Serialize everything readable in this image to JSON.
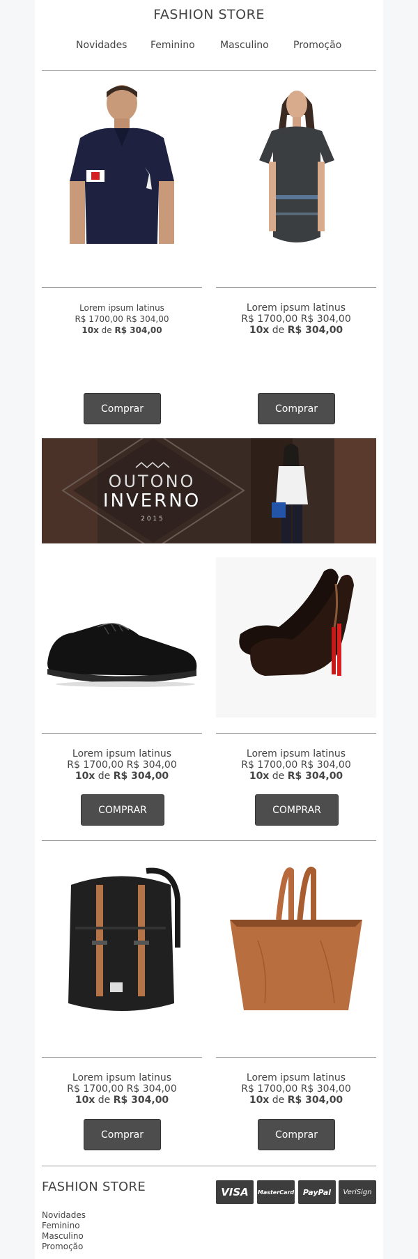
{
  "header": {
    "brand": "FASHION STORE"
  },
  "nav": [
    "Novidades",
    "Feminino",
    "Masculino",
    "Promoção"
  ],
  "products": [
    {
      "name": "Lorem ipsum latinus",
      "price": "R$ 1700,00 R$ 304,00",
      "inst_count": "10x",
      "inst_sep": " de ",
      "inst_value": "R$ 304,00",
      "button": "Comprar",
      "image": "man-polo-shirt"
    },
    {
      "name": "Lorem ipsum latinus",
      "price": "R$ 1700,00 R$ 304,00",
      "inst_count": "10x",
      "inst_sep": " de ",
      "inst_value": "R$ 304,00",
      "button": "Comprar",
      "image": "woman-dress"
    },
    {
      "name": "Lorem ipsum latinus",
      "price": "R$ 1700,00 R$ 304,00",
      "inst_count": "10x",
      "inst_sep": " de ",
      "inst_value": "R$ 304,00",
      "button": "COMPRAR",
      "image": "black-leather-shoe"
    },
    {
      "name": "Lorem ipsum latinus",
      "price": "R$ 1700,00 R$ 304,00",
      "inst_count": "10x",
      "inst_sep": " de ",
      "inst_value": "R$ 304,00",
      "button": "COMPRAR",
      "image": "black-high-heels"
    },
    {
      "name": "Lorem ipsum latinus",
      "price": "R$ 1700,00 R$ 304,00",
      "inst_count": "10x",
      "inst_sep": " de ",
      "inst_value": "R$ 304,00",
      "button": "Comprar",
      "image": "black-backpack"
    },
    {
      "name": "Lorem ipsum latinus",
      "price": "R$ 1700,00 R$ 304,00",
      "inst_count": "10x",
      "inst_sep": " de ",
      "inst_value": "R$ 304,00",
      "button": "Comprar",
      "image": "brown-tote-bag"
    }
  ],
  "banner": {
    "line1": "OUTONO",
    "line2": "INVERNO",
    "year": "2 0 1 5"
  },
  "footer": {
    "brand": "FASHION STORE",
    "links": [
      "Novidades",
      "Feminino",
      "Masculino",
      "Promoção"
    ],
    "payments": [
      "VISA",
      "MasterCard",
      "PayPal",
      "VeriSign"
    ]
  },
  "colors": {
    "button": "#4d4d4d",
    "page_bg": "#f6f7f9",
    "text": "#444444"
  }
}
